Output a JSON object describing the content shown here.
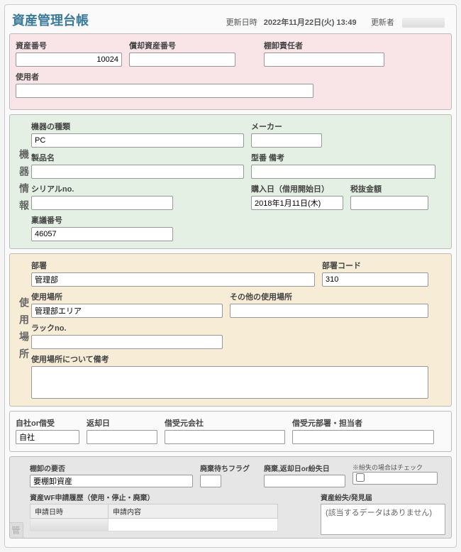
{
  "header": {
    "title": "資産管理台帳",
    "updated_label": "更新日時",
    "updated_value": "2022年11月22日(火) 13:49",
    "updater_label": "更新者"
  },
  "ident": {
    "asset_no_label": "資産番号",
    "asset_no": "10024",
    "depr_no_label": "償却資産番号",
    "depr_no": "",
    "inventory_owner_label": "棚卸責任者",
    "user_label": "使用者"
  },
  "device": {
    "tab": "機器情報",
    "kind_label": "機器の種類",
    "kind": "PC",
    "maker_label": "メーカー",
    "product_label": "製品名",
    "model_remark_label": "型番 備考",
    "serial_label": "シリアルno.",
    "purchase_label": "購入日（借用開始日）",
    "purchase": "2018年1月11日(木)",
    "price_label": "税抜金額",
    "ringi_label": "稟議番号",
    "ringi": "46057"
  },
  "place": {
    "tab": "使用場所",
    "dept_label": "部署",
    "dept": "管理部",
    "dept_code_label": "部署コード",
    "dept_code": "310",
    "loc_label": "使用場所",
    "loc": "管理部エリア",
    "other_loc_label": "その他の使用場所",
    "rack_label": "ラックno.",
    "loc_remark_label": "使用場所について備考"
  },
  "borrow": {
    "own_label": "自社or借受",
    "own": "自社",
    "return_label": "返却日",
    "lender_co_label": "借受元会社",
    "lender_dept_label": "借受元部署・担当者"
  },
  "mgmt": {
    "tab": "管",
    "inv_need_label": "棚卸の要否",
    "inv_need": "要棚卸資産",
    "disposal_flag_label": "廃棄待ちフラグ",
    "disposal_date_label": "廃棄,返却日or紛失日",
    "lost_note": "※紛失の場合はチェック",
    "wf_label": "資産WF申請履歴（使用・停止・廃棄）",
    "wf_cols": {
      "c1": "申請日時",
      "c2": "申請内容"
    },
    "report_label": "資産紛失/発見届",
    "report_text": "(該当するデータはありません)"
  }
}
